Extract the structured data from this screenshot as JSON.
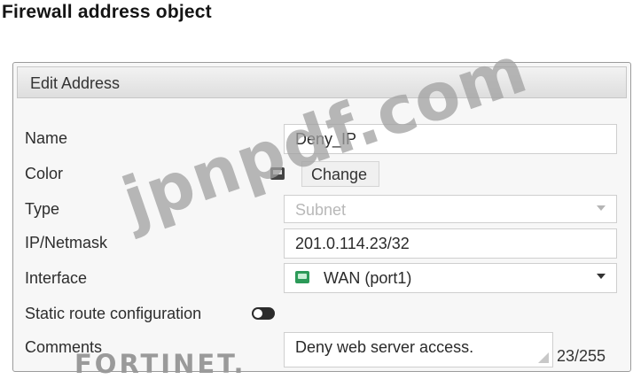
{
  "page": {
    "title": "Firewall address object"
  },
  "panel": {
    "header": "Edit Address"
  },
  "form": {
    "name": {
      "label": "Name",
      "value": "Deny_IP"
    },
    "color": {
      "label": "Color",
      "button_label": "Change",
      "icon": "color-swatch-icon"
    },
    "type": {
      "label": "Type",
      "value": "Subnet"
    },
    "ip_netmask": {
      "label": "IP/Netmask",
      "value": "201.0.114.23/32"
    },
    "interface": {
      "label": "Interface",
      "value": "WAN (port1)",
      "icon": "network-port-icon"
    },
    "static_route": {
      "label": "Static route configuration",
      "enabled": false
    },
    "comments": {
      "label": "Comments",
      "value": "Deny web server access.",
      "counter": "23/255"
    }
  },
  "watermark": "jpnpdf.com",
  "logo": "FORTINET."
}
